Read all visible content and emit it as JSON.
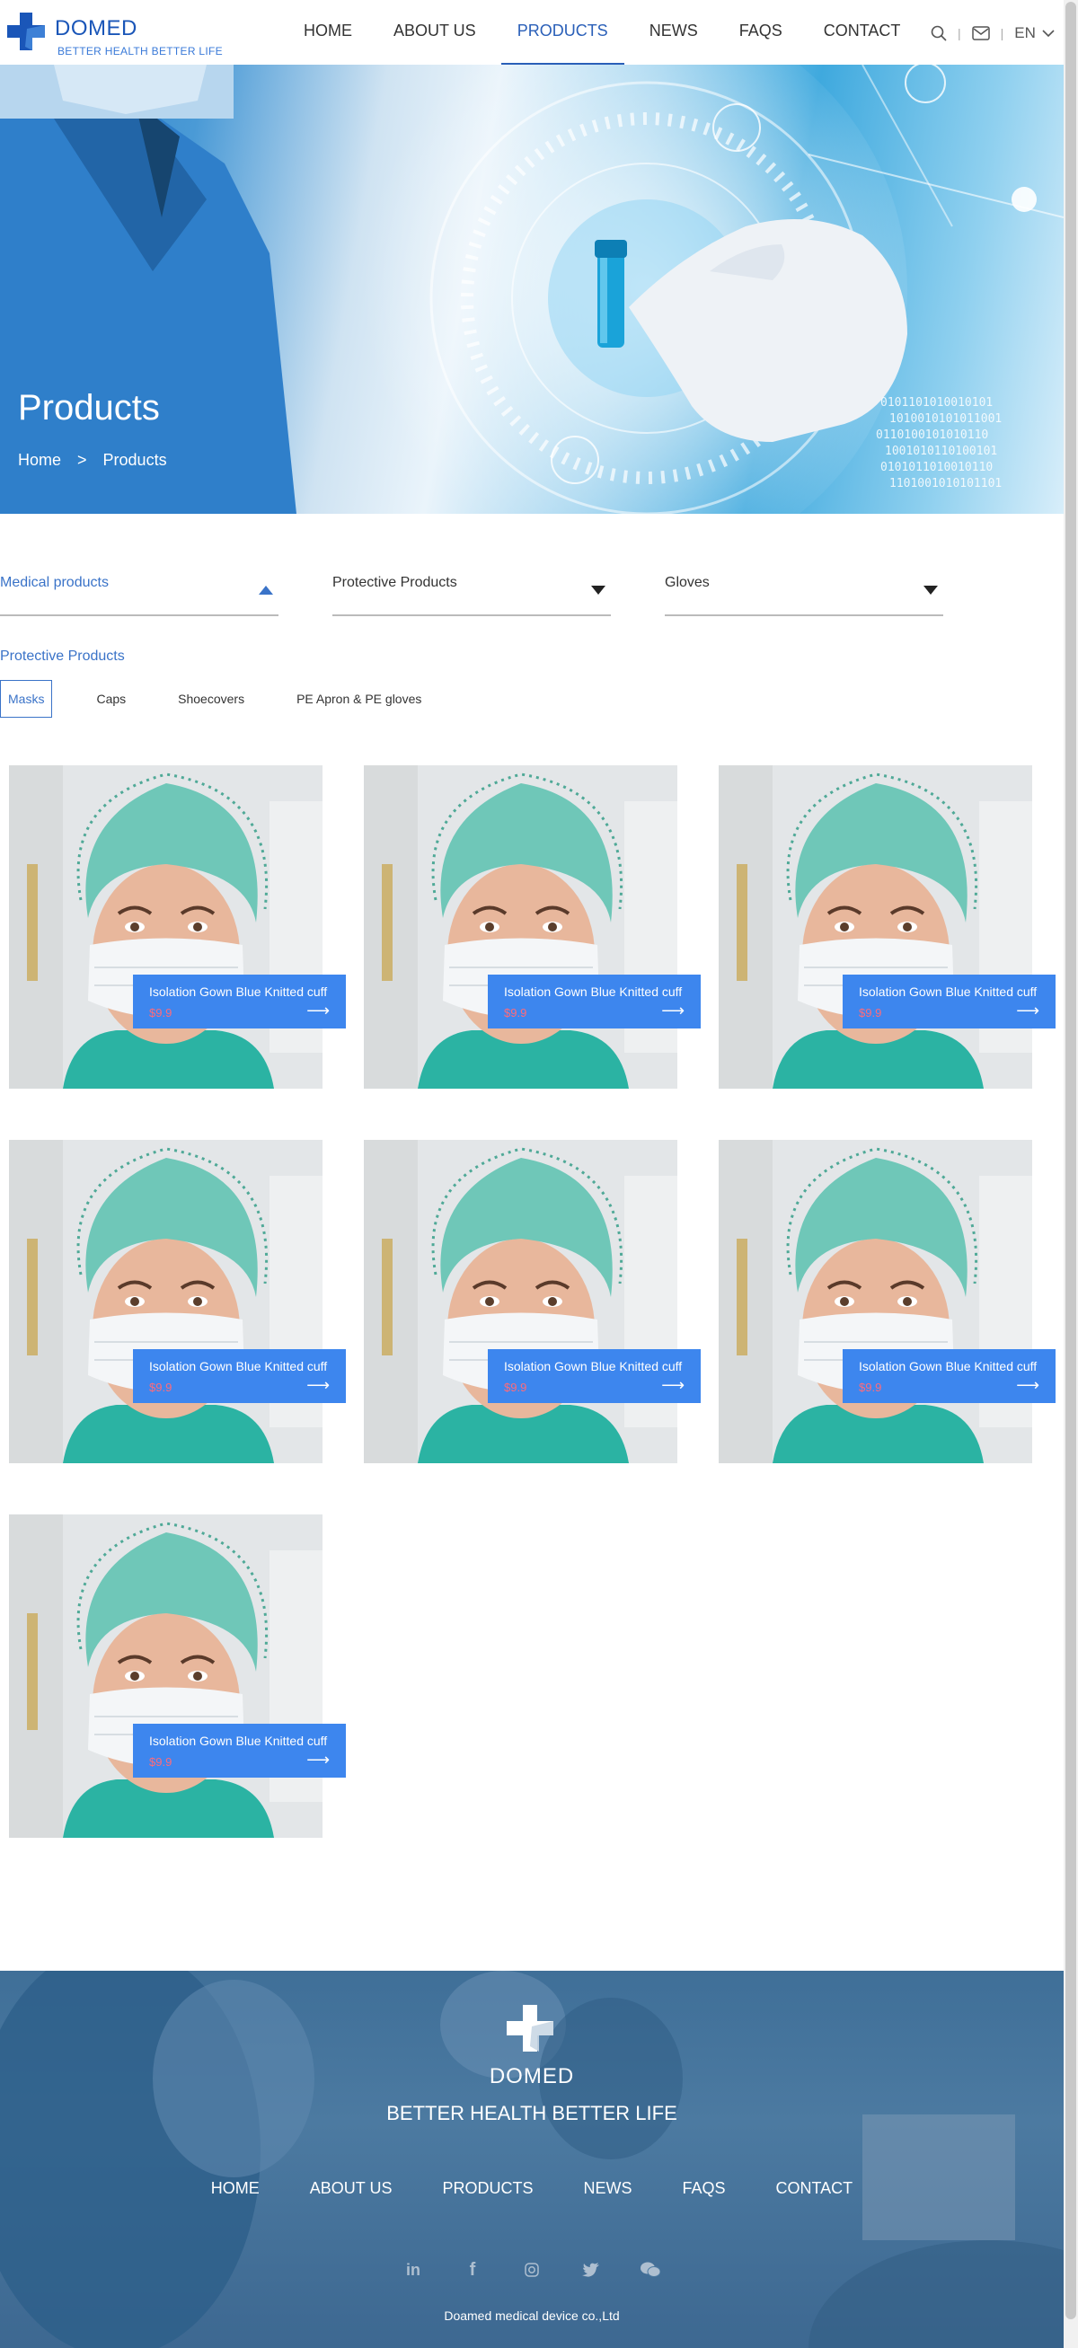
{
  "brand": {
    "name": "DOMED",
    "tagline": "BETTER HEALTH BETTER LIFE"
  },
  "nav": {
    "items": [
      {
        "label": "HOME",
        "active": false
      },
      {
        "label": "ABOUT US",
        "active": false
      },
      {
        "label": "PRODUCTS",
        "active": true
      },
      {
        "label": "NEWS",
        "active": false
      },
      {
        "label": "FAQS",
        "active": false
      },
      {
        "label": "CONTACT",
        "active": false
      }
    ],
    "language": "EN"
  },
  "banner": {
    "title": "Products",
    "breadcrumb": [
      "Home",
      ">",
      "Products"
    ]
  },
  "filters": [
    {
      "label": "Medical products",
      "active": true
    },
    {
      "label": "Protective Products",
      "active": false
    },
    {
      "label": "Gloves",
      "active": false
    }
  ],
  "category_title": "Protective Products",
  "tabs": [
    {
      "label": "Masks",
      "active": true
    },
    {
      "label": "Caps",
      "active": false
    },
    {
      "label": "Shoecovers",
      "active": false
    },
    {
      "label": "PE Apron & PE gloves",
      "active": false
    }
  ],
  "products": [
    {
      "name": "Isolation Gown Blue Knitted cuff",
      "price": "$9.9"
    },
    {
      "name": "Isolation Gown Blue Knitted cuff",
      "price": "$9.9"
    },
    {
      "name": "Isolation Gown Blue Knitted cuff",
      "price": "$9.9"
    },
    {
      "name": "Isolation Gown Blue Knitted cuff",
      "price": "$9.9"
    },
    {
      "name": "Isolation Gown Blue Knitted cuff",
      "price": "$9.9"
    },
    {
      "name": "Isolation Gown Blue Knitted cuff",
      "price": "$9.9"
    },
    {
      "name": "Isolation Gown Blue Knitted cuff",
      "price": "$9.9"
    }
  ],
  "footer": {
    "name": "DOMED",
    "tagline": "BETTER HEALTH BETTER LIFE",
    "nav": [
      "HOME",
      "ABOUT US",
      "PRODUCTS",
      "NEWS",
      "FAQS",
      "CONTACT"
    ],
    "social": [
      "linkedin-icon",
      "facebook-icon",
      "instagram-icon",
      "twitter-icon",
      "wechat-icon"
    ],
    "copyright": "Doamed medical device co.,Ltd"
  },
  "colors": {
    "accent": "#2a5fb8",
    "card": "#3d86ee",
    "price": "#ff6b7a"
  }
}
